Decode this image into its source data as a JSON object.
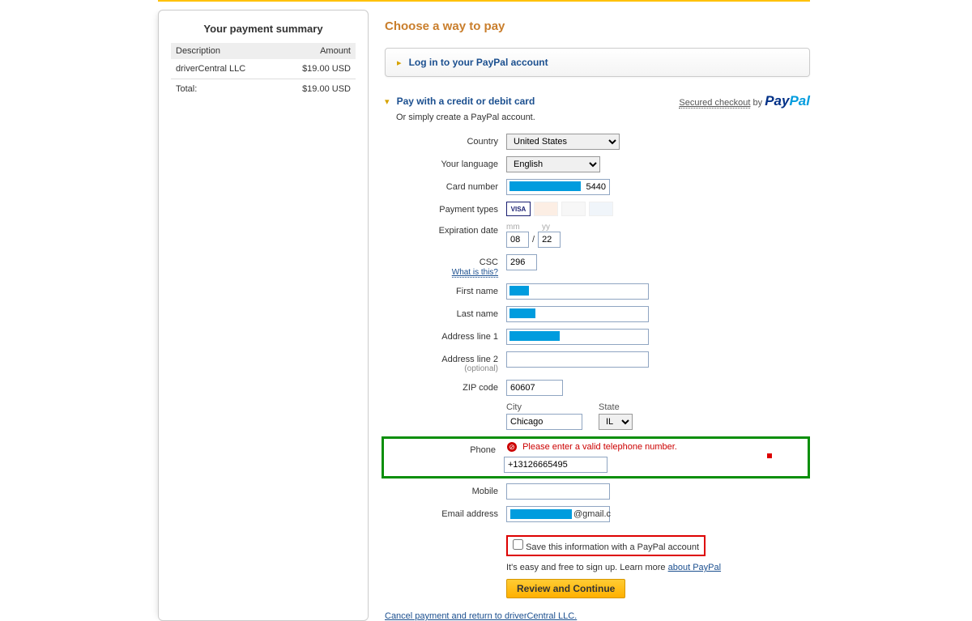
{
  "summary": {
    "title": "Your payment summary",
    "desc_header": "Description",
    "amount_header": "Amount",
    "merchant": "driverCentral LLC",
    "merchant_amount": "$19.00 USD",
    "total_label": "Total:",
    "total_amount": "$19.00 USD"
  },
  "main": {
    "choose_title": "Choose a way to pay",
    "login_link": "Log in to your PayPal account",
    "card_title": "Pay with a credit or debit card",
    "card_sub": "Or simply create a PayPal account.",
    "secured_text": "Secured checkout",
    "secured_by": " by ",
    "paypal_pay": "Pay",
    "paypal_pal": "Pal"
  },
  "labels": {
    "country": "Country",
    "language": "Your language",
    "cardnum": "Card number",
    "payment_types": "Payment types",
    "exp": "Expiration date",
    "exp_mm": "mm",
    "exp_yy": "yy",
    "csc": "CSC",
    "what": "What is this?",
    "first_name": "First name",
    "last_name": "Last name",
    "addr1": "Address line 1",
    "addr2": "Address line 2",
    "addr2_sub": "(optional)",
    "zip": "ZIP code",
    "city": "City",
    "state": "State",
    "phone": "Phone",
    "mobile": "Mobile",
    "email": "Email address"
  },
  "values": {
    "country": "United States",
    "language": "English",
    "cardnum_suffix": "5440",
    "exp_mm": "08",
    "exp_yy": "22",
    "csc": "296",
    "zip": "60607",
    "city": "Chicago",
    "state": "IL",
    "phone": "+13126665495",
    "email_suffix": "@gmail.c"
  },
  "phone_error": "Please enter a valid telephone number.",
  "save_checkbox": "Save this information with a PayPal account",
  "info_text": "It's easy and free to sign up. Learn more ",
  "about_link": "about PayPal",
  "review_btn": "Review and Continue",
  "cancel_link": "Cancel payment and return to driverCentral LLC."
}
